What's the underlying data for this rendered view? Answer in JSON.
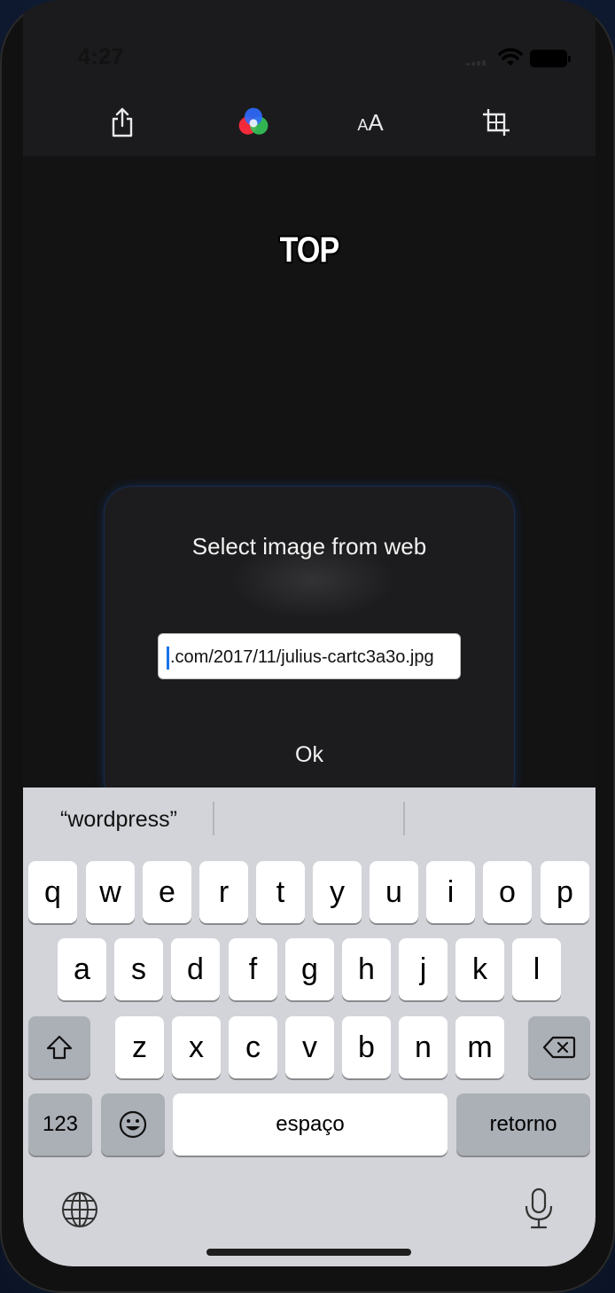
{
  "status_bar": {
    "time": "4:27"
  },
  "toolbar": {
    "text_size_label_small": "A",
    "text_size_label_large": "A"
  },
  "canvas": {
    "caption": "TOP"
  },
  "dialog": {
    "title": "Select image from web",
    "url_value": ".com/2017/11/julius-cartc3a3o.jpg",
    "ok_label": "Ok"
  },
  "keyboard": {
    "suggestions": [
      "“wordpress”",
      "",
      ""
    ],
    "row1": [
      "q",
      "w",
      "e",
      "r",
      "t",
      "y",
      "u",
      "i",
      "o",
      "p"
    ],
    "row2": [
      "a",
      "s",
      "d",
      "f",
      "g",
      "h",
      "j",
      "k",
      "l"
    ],
    "row3": [
      "z",
      "x",
      "c",
      "v",
      "b",
      "n",
      "m"
    ],
    "numbers_label": "123",
    "space_label": "espaço",
    "return_label": "retorno"
  },
  "colors": {
    "accent_caret": "#1a73e8",
    "keyboard_bg": "#d2d4d9",
    "dialog_bg": "#1c1c1e"
  },
  "icons": [
    "share-icon",
    "color-filter-icon",
    "text-size-icon",
    "crop-icon",
    "shift-icon",
    "delete-icon",
    "emoji-icon",
    "globe-icon",
    "microphone-icon"
  ]
}
